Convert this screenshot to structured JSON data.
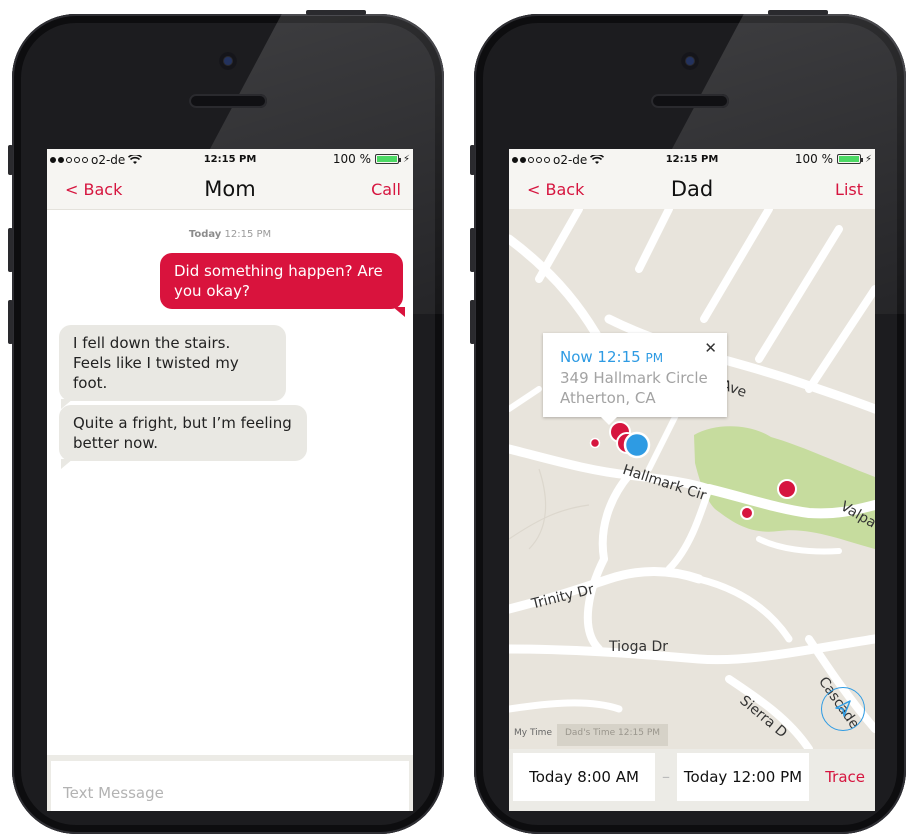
{
  "left_phone": {
    "status": {
      "carrier": "o2-de",
      "time": "12:15 PM",
      "battery": "100 %"
    },
    "nav": {
      "back": "< Back",
      "title": "Mom",
      "action": "Call"
    },
    "thread": {
      "timestamp_day": "Today",
      "timestamp_time": "12:15 PM",
      "messages": [
        {
          "dir": "out",
          "text": "Did something happen? Are you okay?"
        },
        {
          "dir": "in",
          "text": "I fell down the stairs. Feels like I twisted my foot."
        },
        {
          "dir": "in",
          "text": "Quite a fright, but I’m feeling better now."
        }
      ]
    },
    "composer": {
      "placeholder": "Text Message"
    }
  },
  "right_phone": {
    "status": {
      "carrier": "o2-de",
      "time": "12:15 PM",
      "battery": "100 %"
    },
    "nav": {
      "back": "< Back",
      "title": "Dad",
      "action": "List"
    },
    "map": {
      "popup": {
        "time_label": "Now 12:15",
        "time_suffix": "PM",
        "address_line1": "349 Hallmark Circle",
        "address_line2": "Atherton, CA"
      },
      "streets": [
        "Ave",
        "Hallmark Cir",
        "Valpa",
        "Trinity Dr",
        "Tioga Dr",
        "Sierra D",
        "Cascade"
      ],
      "tabs": {
        "my_time": "My Time",
        "dads_time": "Dad's Time 12:15 PM"
      },
      "colors": {
        "park": "#c6dc9e",
        "road": "#ffffff",
        "land": "#e8e4dc",
        "marker": "#d6153f",
        "current": "#2e9be3"
      }
    },
    "range": {
      "from": "Today 8:00 AM",
      "separator": "–",
      "to": "Today 12:00 PM",
      "action": "Trace"
    }
  }
}
